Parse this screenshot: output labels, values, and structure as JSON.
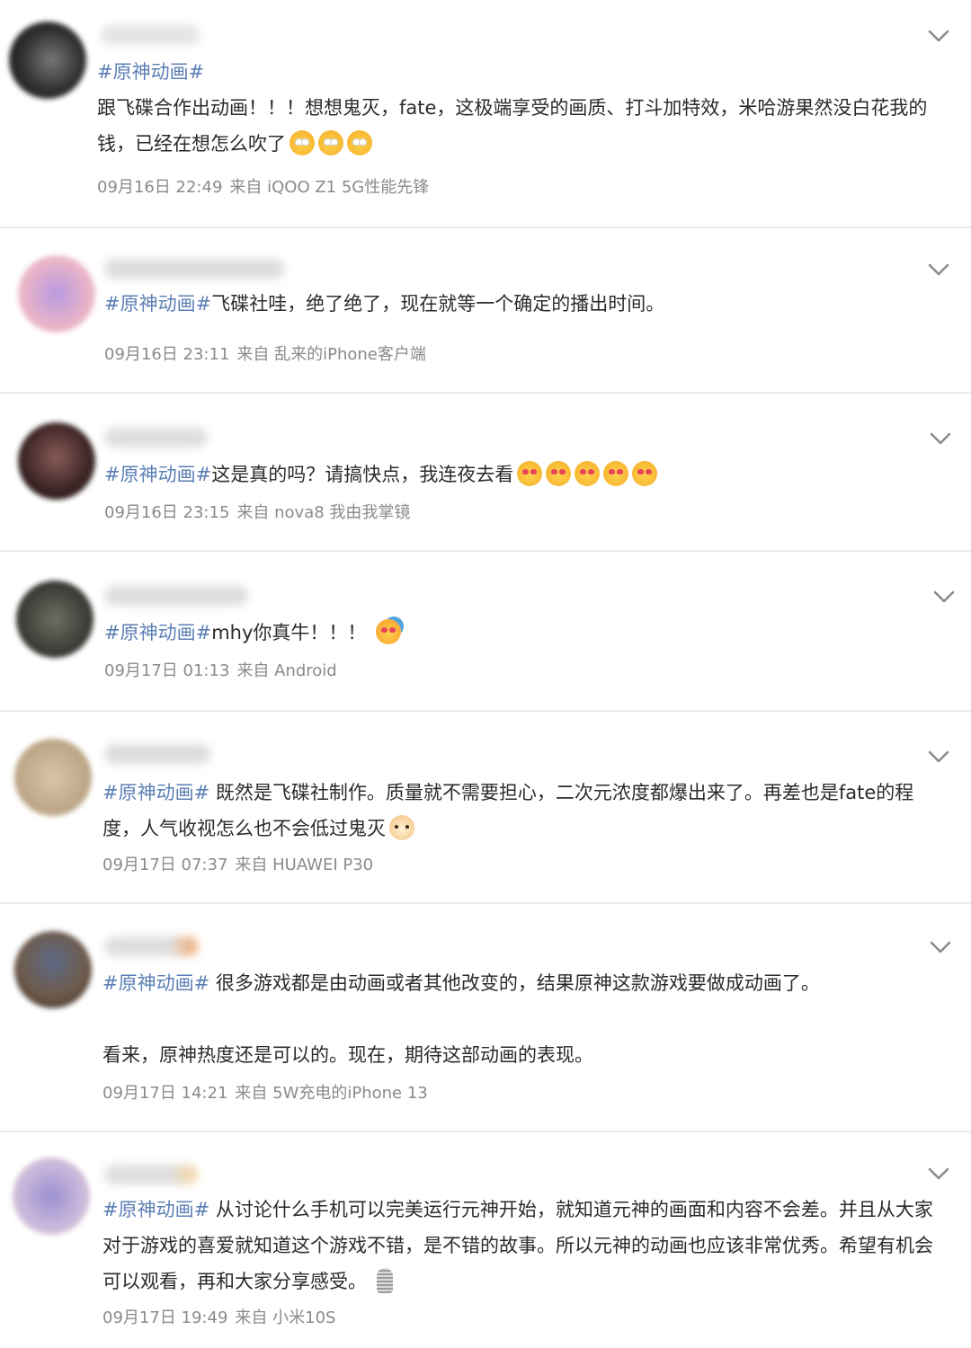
{
  "posts": [
    {
      "hashtag": "#原神动画#",
      "text": "\n跟飞碟合作出动画！！！想想鬼灭，fate，这极端享受的画质、打斗加特效，米哈游果然没白花我的钱，已经在想怎么吹了",
      "emojis": [
        "star-eyes",
        "star-eyes",
        "star-eyes"
      ],
      "time": "09月16日 22:49",
      "source": "来自 iQOO Z1 5G性能先锋"
    },
    {
      "hashtag": "#原神动画#",
      "text": "飞碟社哇，绝了绝了，现在就等一个确定的播出时间。",
      "emojis": [],
      "time": "09月16日 23:11",
      "source": "来自 乱来的iPhone客户端"
    },
    {
      "hashtag": "#原神动画#",
      "text": "这是真的吗？请搞快点，我连夜去看",
      "emojis": [
        "heart-eyes",
        "heart-eyes",
        "heart-eyes",
        "heart-eyes",
        "heart-eyes"
      ],
      "time": "09月16日 23:15",
      "source": "来自 nova8 我由我掌镜"
    },
    {
      "hashtag": "#原神动画#",
      "text": "mhy你真牛！！！",
      "emojis": [
        "party"
      ],
      "time": "09月17日 01:13",
      "source": "来自 Android"
    },
    {
      "hashtag": "#原神动画#",
      "text": " 既然是飞碟社制作。质量就不需要担心，二次元浓度都爆出来了。再差也是fate的程度，人气收视怎么也不会低过鬼灭",
      "emojis": [
        "doge"
      ],
      "time": "09月17日 07:37",
      "source": "来自 HUAWEI P30"
    },
    {
      "hashtag": "#原神动画#",
      "text": " 很多游戏都是由动画或者其他改变的，结果原神这款游戏要做成动画了。\n\n看来，原神热度还是可以的。现在，期待这部动画的表现。",
      "emojis": [],
      "time": "09月17日 14:21",
      "source": "来自 5W充电的iPhone 13"
    },
    {
      "hashtag": "#原神动画#",
      "text": " 从讨论什么手机可以完美运行元神开始，就知道元神的画面和内容不会差。并且从大家对于游戏的喜爱就知道这个游戏不错，是不错的故事。所以元神的动画也应该非常优秀。希望有机会可以观看，再和大家分享感受。",
      "emojis": [
        "microphone"
      ],
      "time": "09月17日 19:49",
      "source": "来自 小米10S"
    }
  ],
  "colors": {
    "hashtag": "#5b7fb5",
    "meta": "#8a8a8a",
    "divider": "#ececec"
  },
  "icons": {
    "menu": "chevron-down-icon"
  }
}
